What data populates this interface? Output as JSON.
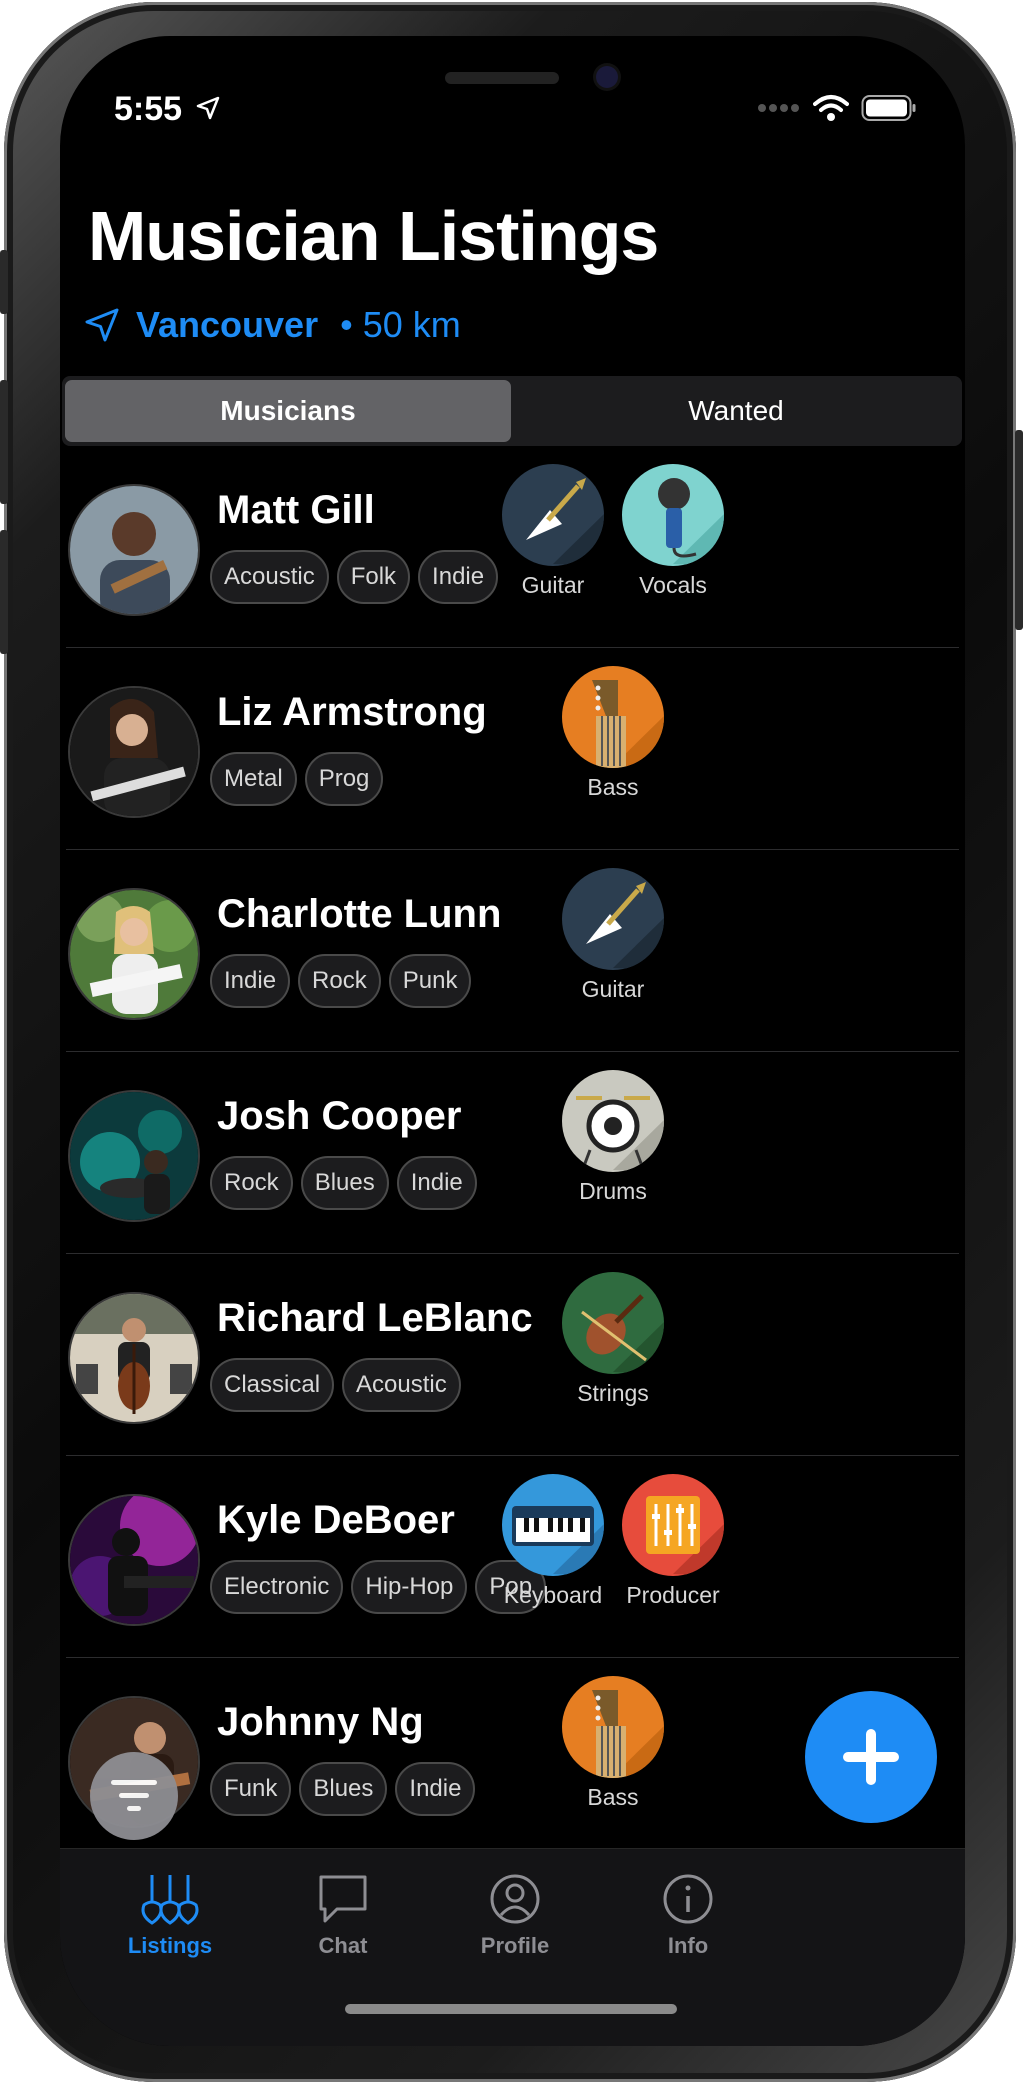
{
  "status_bar": {
    "time": "5:55"
  },
  "header": {
    "title": "Musician Listings",
    "city": "Vancouver",
    "radius": "• 50 km"
  },
  "segments": {
    "musicians": "Musicians",
    "wanted": "Wanted"
  },
  "listings": [
    {
      "name": "Matt Gill",
      "tags": [
        "Acoustic",
        "Folk",
        "Indie"
      ],
      "instruments": [
        {
          "label": "Guitar",
          "icon": "guitar-icon",
          "color": "#2c3e50"
        },
        {
          "label": "Vocals",
          "icon": "microphone-icon",
          "color": "#7fd3cf"
        }
      ]
    },
    {
      "name": "Liz Armstrong",
      "tags": [
        "Metal",
        "Prog"
      ],
      "instruments": [
        {
          "label": "Bass",
          "icon": "bass-icon",
          "color": "#e67e22"
        }
      ]
    },
    {
      "name": "Charlotte Lunn",
      "tags": [
        "Indie",
        "Rock",
        "Punk"
      ],
      "instruments": [
        {
          "label": "Guitar",
          "icon": "guitar-icon",
          "color": "#2c3e50"
        }
      ]
    },
    {
      "name": "Josh Cooper",
      "tags": [
        "Rock",
        "Blues",
        "Indie"
      ],
      "instruments": [
        {
          "label": "Drums",
          "icon": "drums-icon",
          "color": "#c9c9c0"
        }
      ]
    },
    {
      "name": "Richard LeBlanc",
      "tags": [
        "Classical",
        "Acoustic"
      ],
      "instruments": [
        {
          "label": "Strings",
          "icon": "violin-icon",
          "color": "#2f6b3f"
        }
      ]
    },
    {
      "name": "Kyle DeBoer",
      "tags": [
        "Electronic",
        "Hip-Hop",
        "Pop"
      ],
      "instruments": [
        {
          "label": "Keyboard",
          "icon": "keyboard-icon",
          "color": "#3498db"
        },
        {
          "label": "Producer",
          "icon": "mixer-icon",
          "color": "#e74c3c"
        }
      ]
    },
    {
      "name": "Johnny Ng",
      "tags": [
        "Funk",
        "Blues",
        "Indie"
      ],
      "instruments": [
        {
          "label": "Bass",
          "icon": "bass-icon",
          "color": "#e67e22"
        }
      ]
    }
  ],
  "tabs": {
    "listings": "Listings",
    "chat": "Chat",
    "profile": "Profile",
    "info": "Info"
  },
  "colors": {
    "accent": "#1e8cf5",
    "background": "#000000"
  }
}
